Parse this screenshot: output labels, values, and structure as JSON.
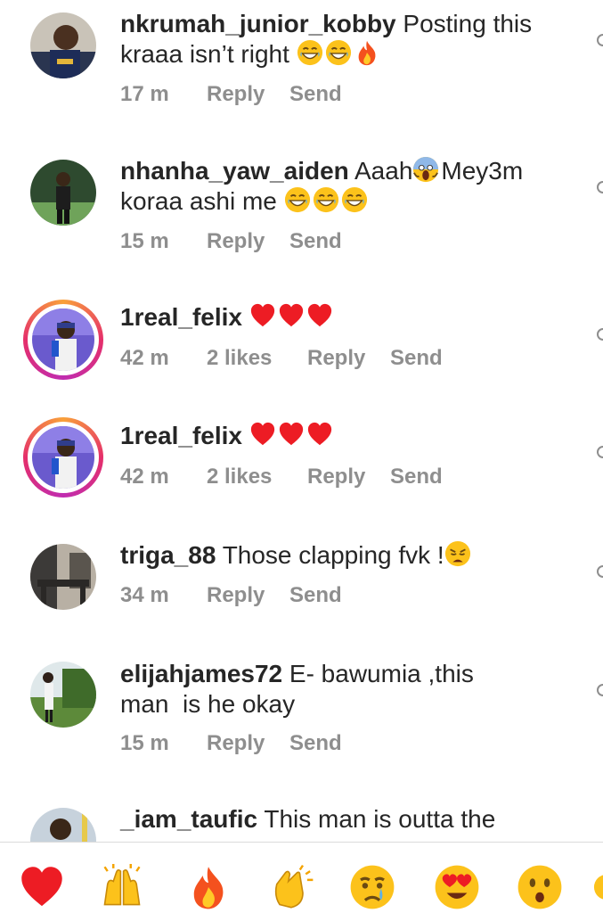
{
  "comments": [
    {
      "username": "nkrumah_junior_kobby",
      "line1_text": "Posting this",
      "line2_text": "kraaa isn’t right",
      "line2_emojis": [
        "grin-sweat-emoji",
        "grin-sweat-emoji",
        "fire-emoji"
      ],
      "time": "17 m",
      "reply": "Reply",
      "send": "Send"
    },
    {
      "username": "nhanha_yaw_aiden",
      "line1_text_a": "Aaah",
      "line1_emoji": "scream-emoji",
      "line1_text_b": "Mey3m",
      "line2_text": "koraa ashi me",
      "line2_emojis": [
        "grin-sweat-emoji",
        "grin-sweat-emoji",
        "grin-sweat-emoji"
      ],
      "time": "15 m",
      "reply": "Reply",
      "send": "Send"
    },
    {
      "username": "1real_felix",
      "line1_emojis": [
        "red-heart-emoji",
        "red-heart-emoji",
        "red-heart-emoji"
      ],
      "time": "42 m",
      "likes": "2 likes",
      "reply": "Reply",
      "send": "Send"
    },
    {
      "username": "1real_felix",
      "line1_emojis": [
        "red-heart-emoji",
        "red-heart-emoji",
        "red-heart-emoji"
      ],
      "time": "42 m",
      "likes": "2 likes",
      "reply": "Reply",
      "send": "Send"
    },
    {
      "username": "triga_88",
      "line1_text": "Those clapping fvk !",
      "line1_emoji": "weary-emoji",
      "time": "34 m",
      "reply": "Reply",
      "send": "Send"
    },
    {
      "username": "elijahjames72",
      "line1_text": "E- bawumia ,this",
      "line2_text": "man  is he okay",
      "time": "15 m",
      "reply": "Reply",
      "send": "Send"
    },
    {
      "username": "_iam_taufic",
      "line1_text": "This man is outta the"
    }
  ],
  "reaction_bar": {
    "reactions": [
      "red-heart",
      "raising-hands",
      "fire",
      "clapping-hands",
      "crying-face",
      "heart-eyes",
      "hushed-face"
    ]
  },
  "colors": {
    "text": "#262626",
    "meta": "#8e8e8e",
    "heart": "#ed1c24",
    "emoji_yellow": "#fcc21b"
  }
}
